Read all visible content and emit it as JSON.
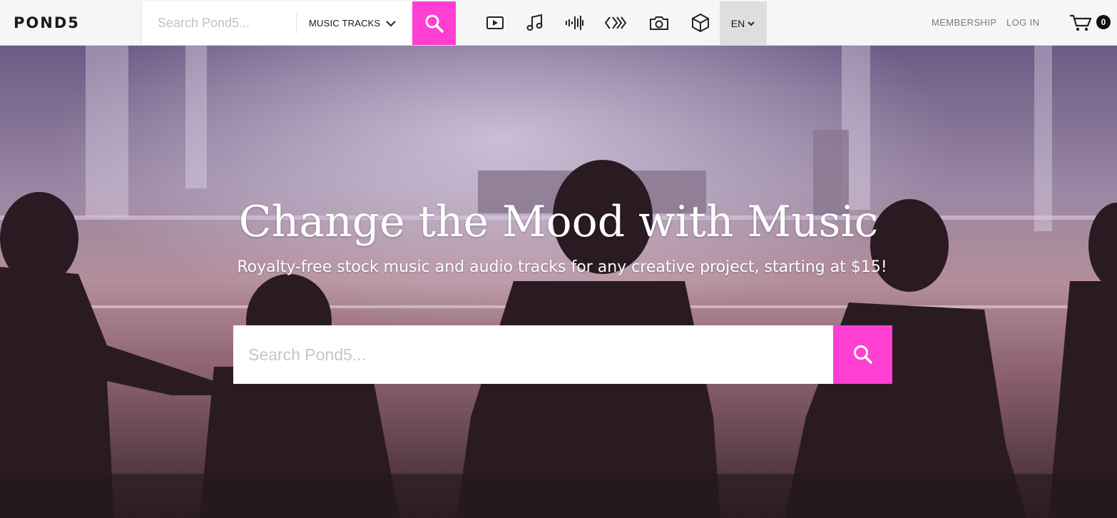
{
  "header": {
    "logo": "POND5",
    "search_placeholder": "Search Pond5...",
    "search_type": "MUSIC TRACKS",
    "media_icons": [
      "video-icon",
      "music-note-icon",
      "sound-effects-icon",
      "after-effects-icon",
      "photo-icon",
      "3d-model-icon"
    ],
    "language": "EN",
    "membership": "MEMBERSHIP",
    "login": "LOG IN",
    "cart_count": "0"
  },
  "hero": {
    "title": "Change the Mood with Music",
    "subtitle": "Royalty-free stock music and audio tracks for any creative project, starting at $15!",
    "search_placeholder": "Search Pond5..."
  },
  "colors": {
    "accent": "#ff3fd2",
    "header_bg": "#f6f6f6",
    "lang_bg": "#dedede"
  }
}
